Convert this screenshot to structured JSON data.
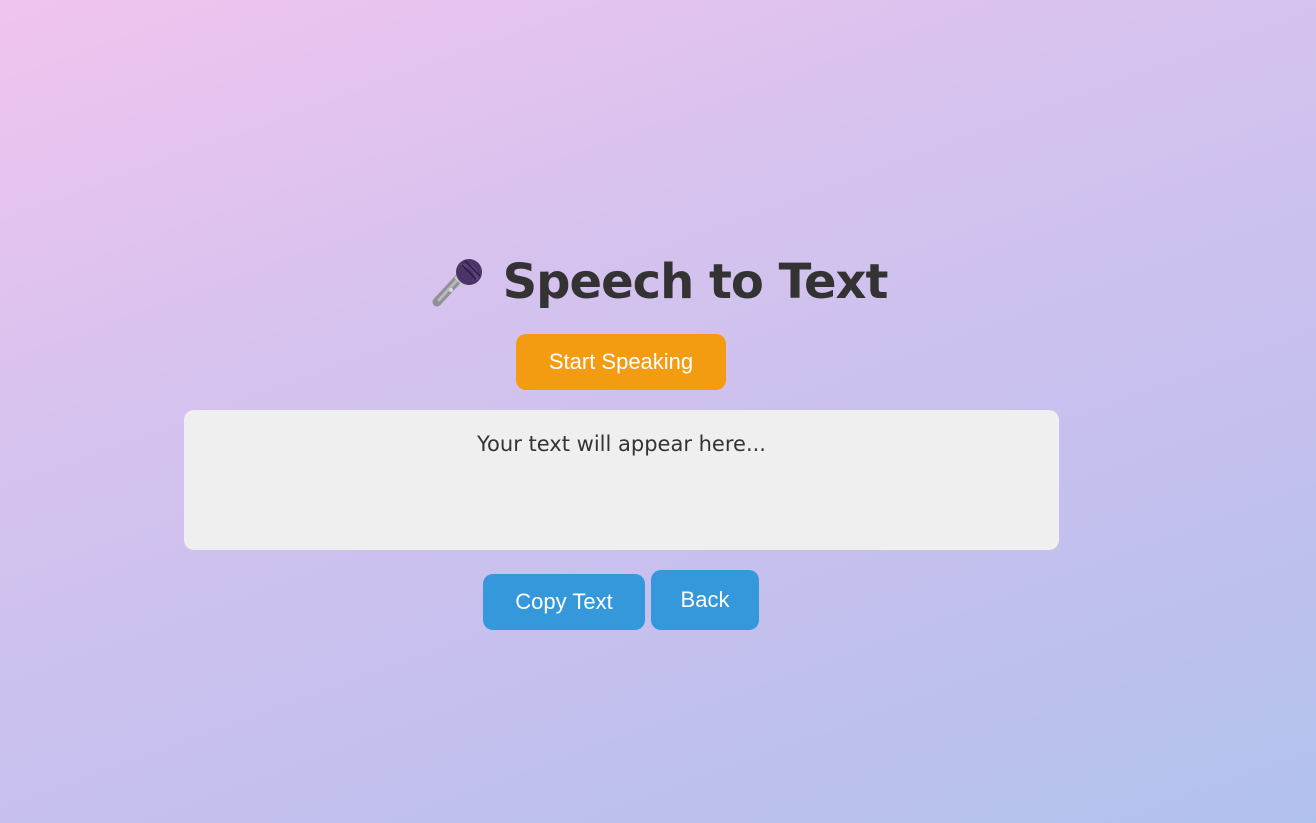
{
  "header": {
    "icon": "microphone-icon",
    "title": "Speech to Text"
  },
  "controls": {
    "start_label": "Start Speaking"
  },
  "output": {
    "placeholder_text": "Your text will appear here..."
  },
  "actions": {
    "copy_label": "Copy Text",
    "back_label": "Back"
  },
  "colors": {
    "start_button": "#f39c12",
    "action_button": "#3498db",
    "title_text": "#333333",
    "output_background": "#efefef"
  }
}
